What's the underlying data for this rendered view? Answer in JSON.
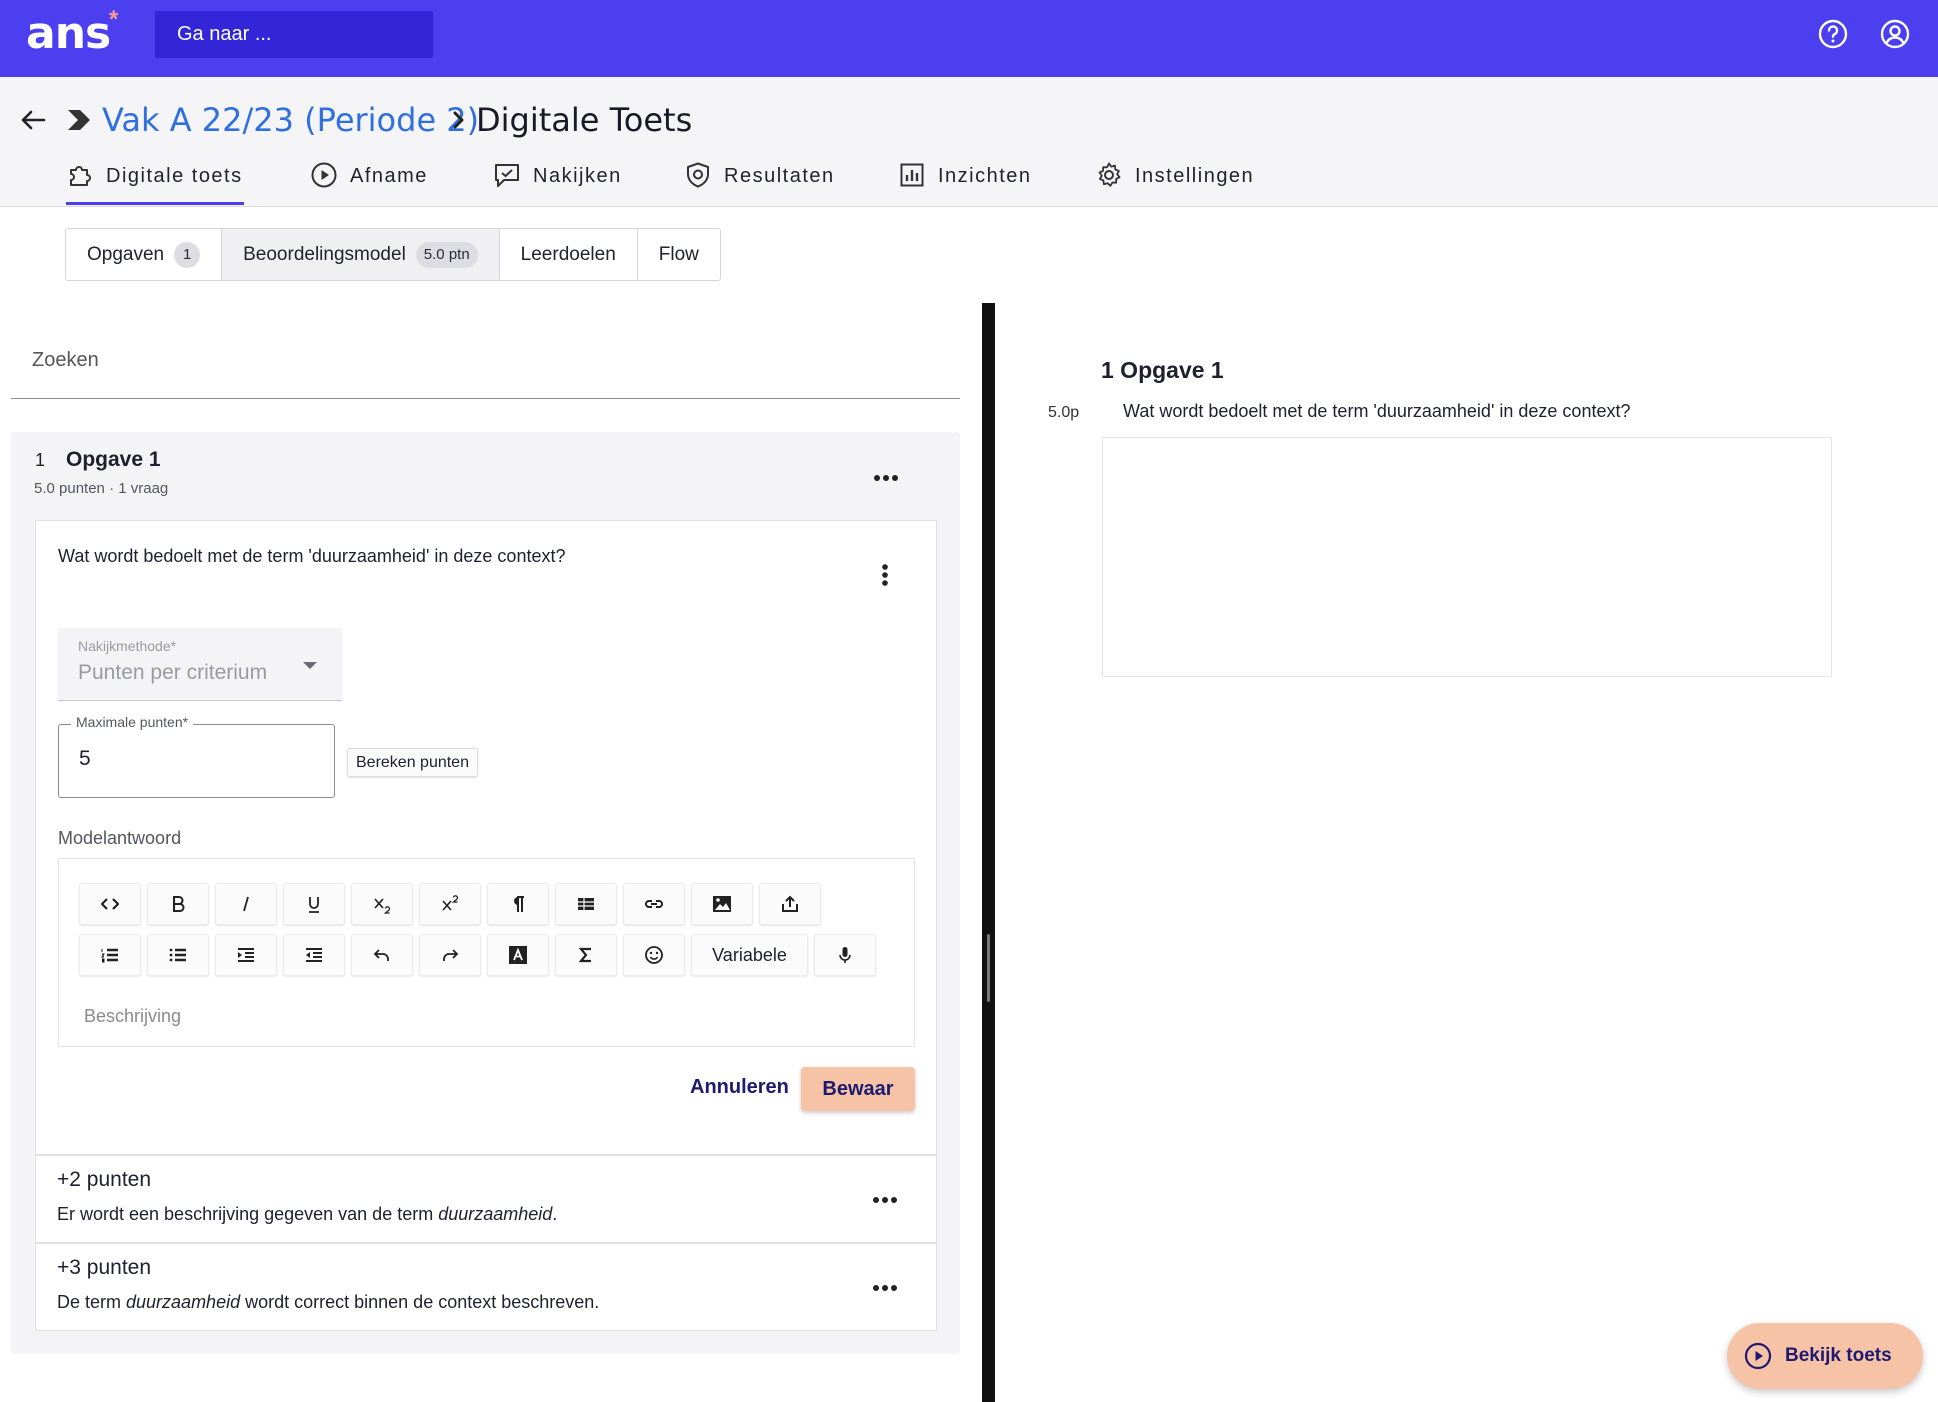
{
  "app": {
    "logo_text": "ans",
    "logo_mark": "*",
    "goto_placeholder": "Ga naar ...",
    "help_icon": "help-circle-icon",
    "account_icon": "user-circle-icon",
    "brand_color": "#4b3ff0",
    "accent_color": "#f7c3a7"
  },
  "header": {
    "breadcrumb_link": "Vak A 22/23 (Periode 2)",
    "breadcrumb_separator": ">",
    "page_title": "Digitale Toets"
  },
  "nav": {
    "items": [
      {
        "label": "Digitale toets",
        "icon": "puzzle-icon",
        "active": true
      },
      {
        "label": "Afname",
        "icon": "play-circle-icon"
      },
      {
        "label": "Nakijken",
        "icon": "comment-check-icon"
      },
      {
        "label": "Resultaten",
        "icon": "shield-icon"
      },
      {
        "label": "Inzichten",
        "icon": "bar-chart-icon"
      },
      {
        "label": "Instellingen",
        "icon": "gear-icon"
      }
    ]
  },
  "subtabs": [
    {
      "label": "Opgaven",
      "badge": "1"
    },
    {
      "label": "Beoordelingsmodel",
      "badge": "5.0 ptn",
      "active": true
    },
    {
      "label": "Leerdoelen"
    },
    {
      "label": "Flow"
    }
  ],
  "left": {
    "search_placeholder": "Zoeken",
    "opgave": {
      "number": "1",
      "title": "Opgave 1",
      "meta": "5.0 punten · 1 vraag"
    },
    "question": {
      "text": "Wat wordt bedoelt met de term 'duurzaamheid' in deze context?",
      "method_label": "Nakijkmethode*",
      "method_value": "Punten per criterium",
      "max_points_label": "Maximale punten*",
      "max_points_value": "5",
      "calc_button": "Bereken punten",
      "model_answer_label": "Modelantwoord",
      "editor_placeholder": "Beschrijving",
      "toolbar_variable": "Variabele",
      "cancel_label": "Annuleren",
      "save_label": "Bewaar"
    },
    "criteria": [
      {
        "title": "+2 punten",
        "desc_before": "Er wordt een beschrijving gegeven van de term ",
        "desc_em": "duurzaamheid",
        "desc_after": "."
      },
      {
        "title": "+3 punten",
        "desc_before": "De term ",
        "desc_em": "duurzaamheid",
        "desc_after": " wordt correct binnen de context beschreven."
      }
    ]
  },
  "preview": {
    "title": "1 Opgave 1",
    "points": "5.0p",
    "question": "Wat wordt bedoelt met de term 'duurzaamheid' in deze context?"
  },
  "fab": {
    "label": "Bekijk toets"
  }
}
